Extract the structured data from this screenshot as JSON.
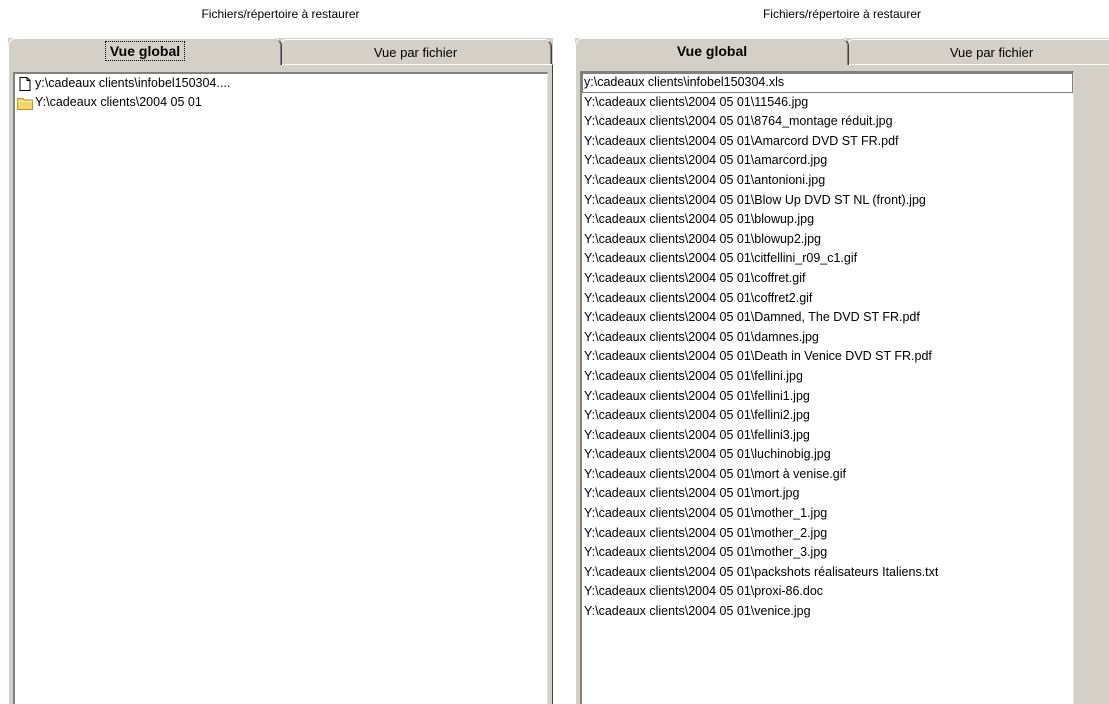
{
  "left_panel": {
    "title": "Fichiers/répertoire à restaurer",
    "tabs": [
      {
        "label": "Vue global",
        "active": true
      },
      {
        "label": "Vue par fichier",
        "active": false
      }
    ],
    "tree_items": [
      {
        "icon": "file-icon",
        "label": "y:\\cadeaux clients\\infobel150304...."
      },
      {
        "icon": "folder-icon",
        "label": "Y:\\cadeaux clients\\2004 05 01"
      }
    ]
  },
  "right_panel": {
    "title": "Fichiers/répertoire à restaurer",
    "tabs": [
      {
        "label": "Vue global",
        "active": true
      },
      {
        "label": "Vue par fichier",
        "active": false
      }
    ],
    "files": [
      "y:\\cadeaux clients\\infobel150304.xls",
      "Y:\\cadeaux clients\\2004 05 01\\11546.jpg",
      "Y:\\cadeaux clients\\2004 05 01\\8764_montage réduit.jpg",
      "Y:\\cadeaux clients\\2004 05 01\\Amarcord DVD ST FR.pdf",
      "Y:\\cadeaux clients\\2004 05 01\\amarcord.jpg",
      "Y:\\cadeaux clients\\2004 05 01\\antonioni.jpg",
      "Y:\\cadeaux clients\\2004 05 01\\Blow Up DVD ST NL (front).jpg",
      "Y:\\cadeaux clients\\2004 05 01\\blowup.jpg",
      "Y:\\cadeaux clients\\2004 05 01\\blowup2.jpg",
      "Y:\\cadeaux clients\\2004 05 01\\citfellini_r09_c1.gif",
      "Y:\\cadeaux clients\\2004 05 01\\coffret.gif",
      "Y:\\cadeaux clients\\2004 05 01\\coffret2.gif",
      "Y:\\cadeaux clients\\2004 05 01\\Damned, The DVD ST FR.pdf",
      "Y:\\cadeaux clients\\2004 05 01\\damnes.jpg",
      "Y:\\cadeaux clients\\2004 05 01\\Death in Venice DVD ST FR.pdf",
      "Y:\\cadeaux clients\\2004 05 01\\fellini.jpg",
      "Y:\\cadeaux clients\\2004 05 01\\fellini1.jpg",
      "Y:\\cadeaux clients\\2004 05 01\\fellini2.jpg",
      "Y:\\cadeaux clients\\2004 05 01\\fellini3.jpg",
      "Y:\\cadeaux clients\\2004 05 01\\luchinobig.jpg",
      "Y:\\cadeaux clients\\2004 05 01\\mort à venise.gif",
      "Y:\\cadeaux clients\\2004 05 01\\mort.jpg",
      "Y:\\cadeaux clients\\2004 05 01\\mother_1.jpg",
      "Y:\\cadeaux clients\\2004 05 01\\mother_2.jpg",
      "Y:\\cadeaux clients\\2004 05 01\\mother_3.jpg",
      "Y:\\cadeaux clients\\2004 05 01\\packshots réalisateurs Italiens.txt",
      "Y:\\cadeaux clients\\2004 05 01\\proxi-86.doc",
      "Y:\\cadeaux clients\\2004 05 01\\venice.jpg"
    ]
  },
  "colors": {
    "folder": "#f4d56a",
    "folder_dark": "#b8962e",
    "face": "#d4d0c8"
  }
}
